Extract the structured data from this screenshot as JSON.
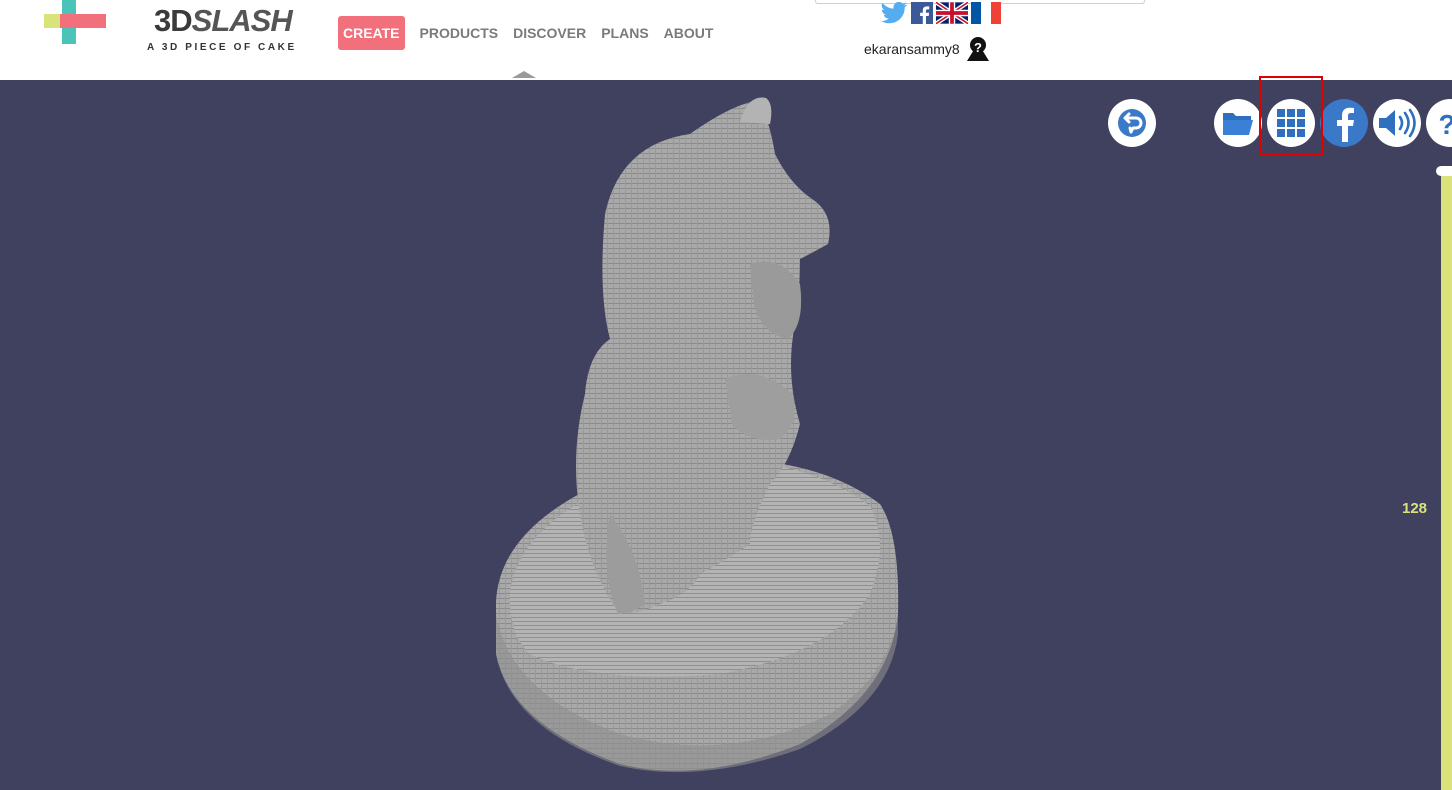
{
  "brand": {
    "name_bold": "3D",
    "name_italic": "SLASH",
    "tagline": "A 3D PIECE OF CAKE",
    "colors": {
      "pink": "#f2707b",
      "teal": "#4cc3b8",
      "yellow": "#d9e37a"
    }
  },
  "nav": {
    "items": [
      {
        "label": "CREATE",
        "active": true
      },
      {
        "label": "PRODUCTS"
      },
      {
        "label": "DISCOVER"
      },
      {
        "label": "PLANS"
      },
      {
        "label": "ABOUT"
      }
    ]
  },
  "social": {
    "icons": [
      "twitter-icon",
      "facebook-icon",
      "uk-flag-icon",
      "france-flag-icon"
    ]
  },
  "user": {
    "name": "ekaransammy8",
    "avatar_icon": "user-help-icon"
  },
  "toolbar": {
    "buttons": [
      "undo-icon",
      "folder-icon",
      "grid-icon",
      "facebook-icon",
      "sound-icon",
      "help-icon"
    ],
    "highlighted": "grid-icon"
  },
  "viewport": {
    "background": "#40405f",
    "model_color": "#a9a9a9",
    "slider": {
      "value": "128",
      "color": "#d9e37a"
    }
  }
}
